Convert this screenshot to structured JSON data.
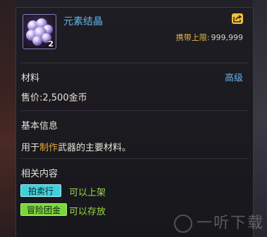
{
  "item": {
    "name": "元素结晶",
    "count": "2",
    "icon": "purple-crystal-cluster-icon"
  },
  "carry": {
    "label": "携带上限:",
    "value": "999,999"
  },
  "info": {
    "type": "材料",
    "grade": "高级",
    "price": "售价:2,500金币"
  },
  "basic": {
    "title": "基本信息",
    "desc_prefix": "用于",
    "desc_highlight": "制作",
    "desc_suffix": "武器的主要材料。"
  },
  "related": {
    "title": "相关内容",
    "tags": [
      {
        "label": "拍卖行",
        "note": "可以上架"
      },
      {
        "label": "冒险团金库",
        "note": "可以存放"
      }
    ]
  },
  "watermark": "一听下载",
  "colors": {
    "accent_blue": "#5fb6e8",
    "accent_gold": "#e8b84a",
    "note_green": "#9ad84a"
  }
}
